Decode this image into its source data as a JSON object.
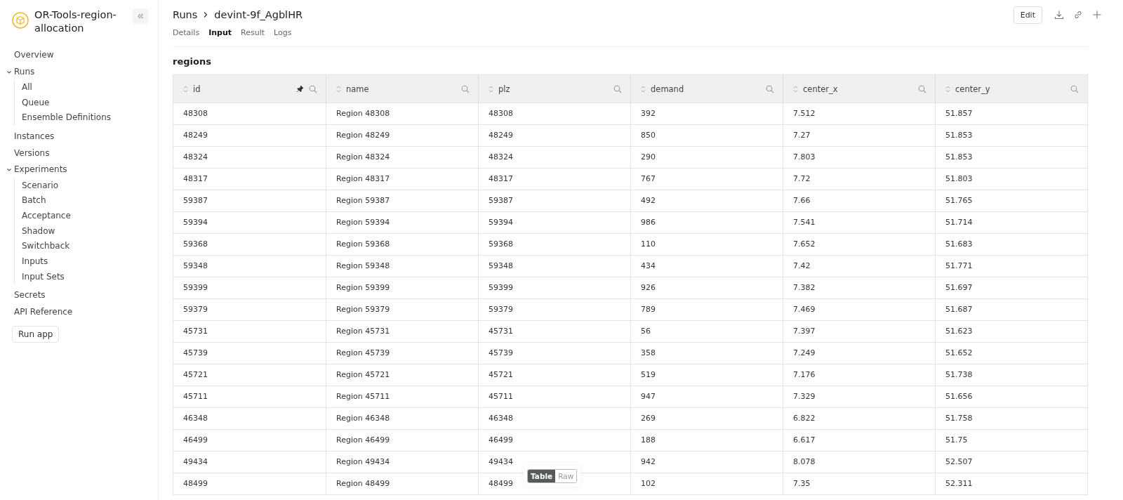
{
  "app": {
    "title": "OR-Tools-region-allocation"
  },
  "sidebar": {
    "items": [
      {
        "label": "Overview"
      },
      {
        "label": "Runs",
        "expanded": true,
        "children": [
          {
            "label": "All"
          },
          {
            "label": "Queue"
          },
          {
            "label": "Ensemble Definitions"
          }
        ]
      },
      {
        "label": "Instances"
      },
      {
        "label": "Versions"
      },
      {
        "label": "Experiments",
        "expanded": true,
        "children": [
          {
            "label": "Scenario"
          },
          {
            "label": "Batch"
          },
          {
            "label": "Acceptance"
          },
          {
            "label": "Shadow"
          },
          {
            "label": "Switchback"
          },
          {
            "label": "Inputs"
          },
          {
            "label": "Input Sets"
          }
        ]
      },
      {
        "label": "Secrets"
      },
      {
        "label": "API Reference"
      }
    ],
    "run_button": "Run app"
  },
  "breadcrumb": [
    "Runs",
    "devint-9f_AgblHR"
  ],
  "actions": {
    "edit": "Edit"
  },
  "tabs": [
    {
      "label": "Details",
      "selected": false
    },
    {
      "label": "Input",
      "selected": true
    },
    {
      "label": "Result",
      "selected": false
    },
    {
      "label": "Logs",
      "selected": false
    }
  ],
  "section_title": "regions",
  "table": {
    "columns": [
      {
        "label": "id",
        "pinned": true
      },
      {
        "label": "name",
        "pinned": false
      },
      {
        "label": "plz",
        "pinned": false
      },
      {
        "label": "demand",
        "pinned": false
      },
      {
        "label": "center_x",
        "pinned": false
      },
      {
        "label": "center_y",
        "pinned": false
      }
    ],
    "rows": [
      [
        "48308",
        "Region 48308",
        "48308",
        "392",
        "7.512",
        "51.857"
      ],
      [
        "48249",
        "Region 48249",
        "48249",
        "850",
        "7.27",
        "51.853"
      ],
      [
        "48324",
        "Region 48324",
        "48324",
        "290",
        "7.803",
        "51.853"
      ],
      [
        "48317",
        "Region 48317",
        "48317",
        "767",
        "7.72",
        "51.803"
      ],
      [
        "59387",
        "Region 59387",
        "59387",
        "492",
        "7.66",
        "51.765"
      ],
      [
        "59394",
        "Region 59394",
        "59394",
        "986",
        "7.541",
        "51.714"
      ],
      [
        "59368",
        "Region 59368",
        "59368",
        "110",
        "7.652",
        "51.683"
      ],
      [
        "59348",
        "Region 59348",
        "59348",
        "434",
        "7.42",
        "51.771"
      ],
      [
        "59399",
        "Region 59399",
        "59399",
        "926",
        "7.382",
        "51.697"
      ],
      [
        "59379",
        "Region 59379",
        "59379",
        "789",
        "7.469",
        "51.687"
      ],
      [
        "45731",
        "Region 45731",
        "45731",
        "56",
        "7.397",
        "51.623"
      ],
      [
        "45739",
        "Region 45739",
        "45739",
        "358",
        "7.249",
        "51.652"
      ],
      [
        "45721",
        "Region 45721",
        "45721",
        "519",
        "7.176",
        "51.738"
      ],
      [
        "45711",
        "Region 45711",
        "45711",
        "947",
        "7.329",
        "51.656"
      ],
      [
        "46348",
        "Region 46348",
        "46348",
        "269",
        "6.822",
        "51.758"
      ],
      [
        "46499",
        "Region 46499",
        "46499",
        "188",
        "6.617",
        "51.75"
      ],
      [
        "49434",
        "Region 49434",
        "49434",
        "942",
        "8.078",
        "52.507"
      ],
      [
        "48499",
        "Region 48499",
        "48499",
        "102",
        "7.35",
        "52.311"
      ]
    ]
  },
  "view_toggle": [
    {
      "label": "Table",
      "selected": true
    },
    {
      "label": "Raw",
      "selected": false
    }
  ]
}
